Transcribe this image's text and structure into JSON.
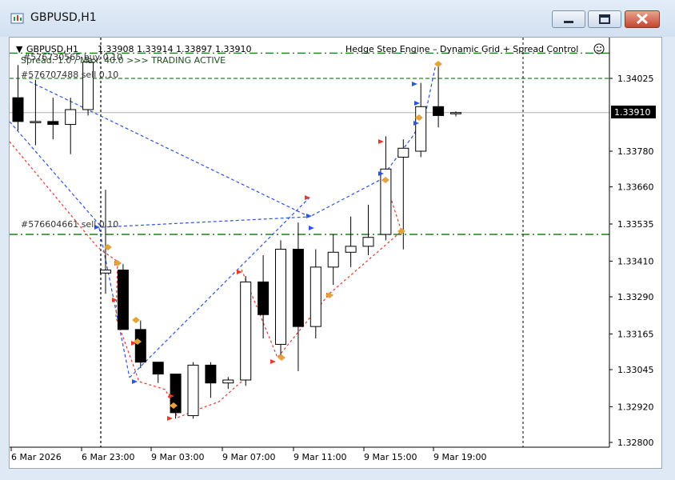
{
  "window": {
    "title": "GBPUSD,H1",
    "minimize_icon": "minimize-icon",
    "maximize_icon": "maximize-icon",
    "close_icon": "close-icon"
  },
  "chart": {
    "header_symbol": "GBPUSD,H1",
    "header_ohlc": "1.33908 1.33914 1.33897 1.33910",
    "ea_name": "Hedge Step Engine – Dynamic Grid + Spread Control",
    "status_text": "Spread: 1.0 / Max: 40.0 >>> TRADING ACTIVE",
    "order_labels": [
      "#576730565 buy 0.10",
      "#576707488 sell 0.10",
      "#576604661 sell 0.10"
    ],
    "current_price": "1.33910",
    "colors": {
      "buy_line": "#2b54e8",
      "sell_line": "#e83b2b",
      "level_line": "#1e7d1e",
      "bid_line": "#b0b0b0",
      "candle_bear": "#000000",
      "candle_bull": "#ffffff"
    }
  },
  "chart_data": {
    "type": "candlestick",
    "symbol": "GBPUSD",
    "timeframe": "H1",
    "y_ticks": [
      "1.34025",
      "1.33780",
      "1.33660",
      "1.33535",
      "1.33410",
      "1.33290",
      "1.33165",
      "1.33045",
      "1.32920",
      "1.32800"
    ],
    "x_ticks": [
      "6 Mar 2026",
      "6 Mar 23:00",
      "9 Mar 03:00",
      "9 Mar 07:00",
      "9 Mar 11:00",
      "9 Mar 15:00",
      "9 Mar 19:00"
    ],
    "ylim": [
      1.3278,
      1.3413
    ],
    "horizontal_levels": [
      {
        "price": 1.3411,
        "style": "dash-dot",
        "color": "#1e7d1e"
      },
      {
        "price": 1.34025,
        "style": "dashed",
        "color": "#4f9a4f"
      },
      {
        "price": 1.3391,
        "style": "solid",
        "color": "#b0b0b0"
      },
      {
        "price": 1.335,
        "style": "dash-dot",
        "color": "#1e7d1e"
      }
    ],
    "candles": [
      {
        "o": 1.3396,
        "h": 1.3407,
        "l": 1.3385,
        "c": 1.3388
      },
      {
        "o": 1.3388,
        "h": 1.3402,
        "l": 1.338,
        "c": 1.3388
      },
      {
        "o": 1.3388,
        "h": 1.3396,
        "l": 1.3382,
        "c": 1.3387
      },
      {
        "o": 1.3387,
        "h": 1.3396,
        "l": 1.3377,
        "c": 1.3392
      },
      {
        "o": 1.3392,
        "h": 1.341,
        "l": 1.339,
        "c": 1.3408
      },
      {
        "o": 1.3337,
        "h": 1.3365,
        "l": 1.333,
        "c": 1.3338
      },
      {
        "o": 1.3338,
        "h": 1.334,
        "l": 1.3318,
        "c": 1.3318
      },
      {
        "o": 1.3318,
        "h": 1.3321,
        "l": 1.3305,
        "c": 1.3307
      },
      {
        "o": 1.3307,
        "h": 1.3307,
        "l": 1.33,
        "c": 1.3303
      },
      {
        "o": 1.3303,
        "h": 1.33,
        "l": 1.3288,
        "c": 1.329
      },
      {
        "o": 1.3289,
        "h": 1.3307,
        "l": 1.3288,
        "c": 1.3306
      },
      {
        "o": 1.3306,
        "h": 1.3307,
        "l": 1.3295,
        "c": 1.33
      },
      {
        "o": 1.33,
        "h": 1.3302,
        "l": 1.3298,
        "c": 1.3301
      },
      {
        "o": 1.3301,
        "h": 1.3336,
        "l": 1.3299,
        "c": 1.3334
      },
      {
        "o": 1.3334,
        "h": 1.3343,
        "l": 1.3315,
        "c": 1.3323
      },
      {
        "o": 1.3313,
        "h": 1.3348,
        "l": 1.3309,
        "c": 1.3345
      },
      {
        "o": 1.3345,
        "h": 1.3354,
        "l": 1.3304,
        "c": 1.3319
      },
      {
        "o": 1.3319,
        "h": 1.3345,
        "l": 1.3315,
        "c": 1.3339
      },
      {
        "o": 1.3339,
        "h": 1.335,
        "l": 1.3333,
        "c": 1.3344
      },
      {
        "o": 1.3344,
        "h": 1.3356,
        "l": 1.3339,
        "c": 1.3346
      },
      {
        "o": 1.3346,
        "h": 1.336,
        "l": 1.3343,
        "c": 1.3349
      },
      {
        "o": 1.335,
        "h": 1.3383,
        "l": 1.3348,
        "c": 1.3372
      },
      {
        "o": 1.3376,
        "h": 1.3382,
        "l": 1.3345,
        "c": 1.3379
      },
      {
        "o": 1.3378,
        "h": 1.3401,
        "l": 1.3376,
        "c": 1.3393
      },
      {
        "o": 1.3393,
        "h": 1.3408,
        "l": 1.3386,
        "c": 1.339
      },
      {
        "o": 1.33908,
        "h": 1.33914,
        "l": 1.33897,
        "c": 1.3391
      }
    ]
  }
}
